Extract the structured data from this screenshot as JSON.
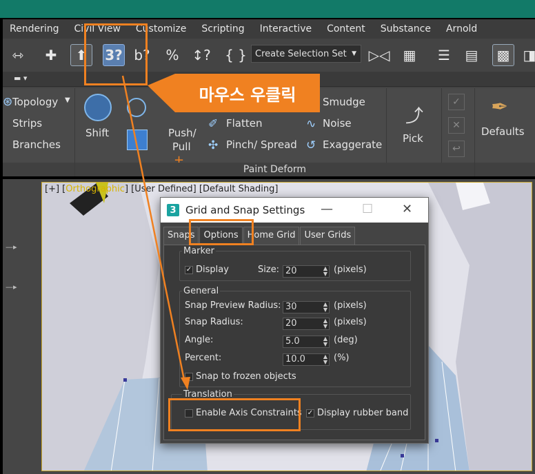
{
  "menubar": [
    "Rendering",
    "Civil View",
    "Customize",
    "Scripting",
    "Interactive",
    "Content",
    "Substance",
    "Arnold"
  ],
  "toolbar": {
    "snap_button": "3?",
    "angle_snap": "b?",
    "percent_snap": "%",
    "spinner_snap": "↕?",
    "brace_icon": "{ }",
    "selection_set": "Create Selection Set"
  },
  "ribbon": {
    "topology": "Topology",
    "strips": "Strips",
    "branches": "Branches",
    "shift": "Shift",
    "push_pull": "Push/",
    "pull": "Pull",
    "smudge": "Smudge",
    "flatten": "Flatten",
    "noise": "Noise",
    "pinch_spread": "Pinch/ Spread",
    "exaggerate": "Exaggerate",
    "pick": "Pick",
    "defaults": "Defaults",
    "paint_deform": "Paint Deform"
  },
  "viewport": {
    "label_prefix": "[+] [",
    "label_ortho": "Orthographic",
    "label_suffix": "] [User Defined] [Default Shading]"
  },
  "callout": "마우스 우클릭",
  "dialog": {
    "title": "Grid and Snap Settings",
    "logo": "3",
    "tabs": [
      "Snaps",
      "Options",
      "Home Grid",
      "User Grids"
    ],
    "marker": {
      "title": "Marker",
      "display_label": "Display",
      "size_label": "Size:",
      "size_value": "20",
      "size_unit": "(pixels)"
    },
    "general": {
      "title": "General",
      "snap_preview_radius_label": "Snap Preview Radius:",
      "snap_preview_radius_value": "30",
      "snap_radius_label": "Snap Radius:",
      "snap_radius_value": "20",
      "angle_label": "Angle:",
      "angle_value": "5.0",
      "angle_unit": "(deg)",
      "percent_label": "Percent:",
      "percent_value": "10.0",
      "percent_unit": "(%)",
      "pixels_unit": "(pixels)",
      "snap_frozen_label": "Snap to frozen objects"
    },
    "translation": {
      "title": "Translation",
      "enable_axis_label": "Enable Axis Constraints",
      "rubber_band_label": "Display rubber band"
    }
  },
  "colors": {
    "accent_orange": "#f08121",
    "active_blue": "#5a7fb0",
    "title_strip": "#127a68"
  }
}
